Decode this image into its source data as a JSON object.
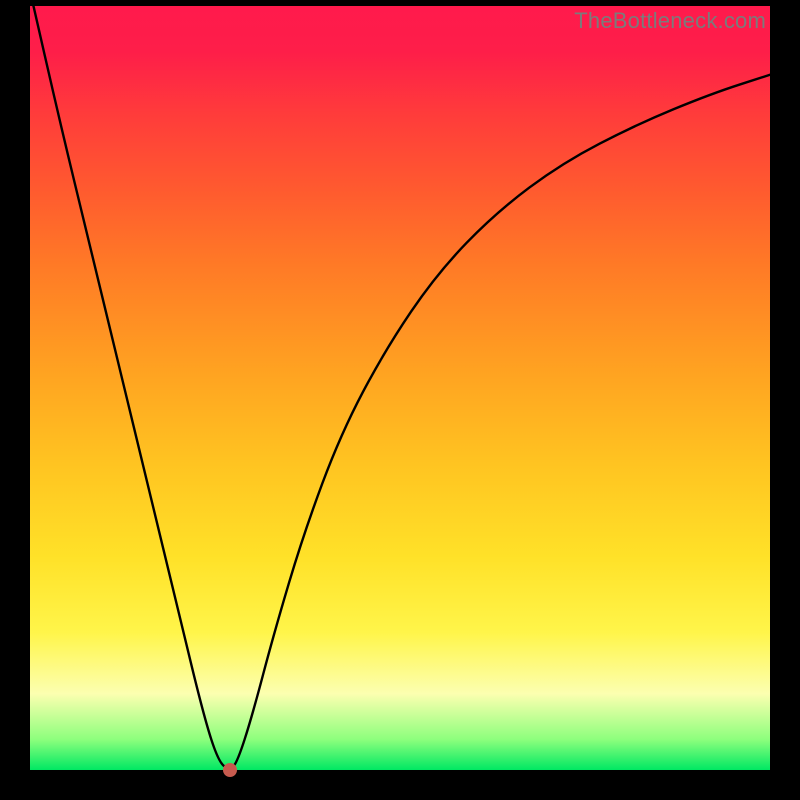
{
  "watermark": "TheBottleneck.com",
  "chart_data": {
    "type": "line",
    "title": "",
    "xlabel": "",
    "ylabel": "",
    "xlim": [
      0,
      100
    ],
    "ylim": [
      0,
      100
    ],
    "grid": false,
    "background_gradient": {
      "top_color": "#ff1a4c",
      "mid_color": "#ffc421",
      "bottom_color": "#00e863"
    },
    "series": [
      {
        "name": "bottleneck-curve",
        "x": [
          0,
          4,
          8,
          12,
          16,
          20,
          23.5,
          25.5,
          27,
          28,
          30,
          33,
          37,
          42,
          48,
          55,
          63,
          72,
          82,
          92,
          100
        ],
        "values": [
          102,
          85,
          69,
          53,
          37,
          21,
          7,
          1,
          0,
          1,
          7,
          18,
          31,
          44,
          55,
          65,
          73,
          79.5,
          84.5,
          88.5,
          91
        ]
      }
    ],
    "marker": {
      "x": 27,
      "y": 0,
      "color": "#c65a4e"
    }
  }
}
